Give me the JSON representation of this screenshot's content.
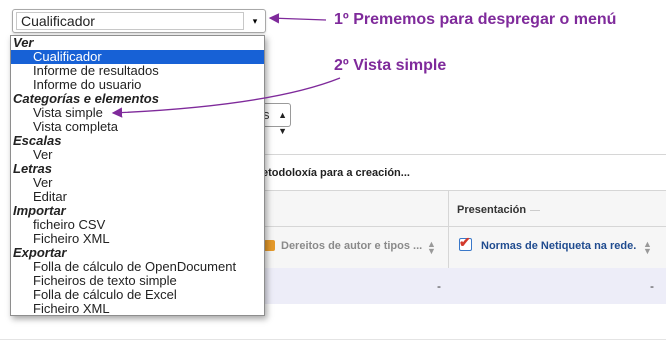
{
  "select": {
    "value": "Cualificador",
    "arrow": "▾"
  },
  "dropdown": {
    "groups": [
      {
        "label": "Ver",
        "options": [
          "Cualificador",
          "Informe de resultados",
          "Informe do usuario"
        ]
      },
      {
        "label": "Categorías e elementos",
        "options": [
          "Vista simple",
          "Vista completa"
        ]
      },
      {
        "label": "Escalas",
        "options": [
          "Ver"
        ]
      },
      {
        "label": "Letras",
        "options": [
          "Ver",
          "Editar"
        ]
      },
      {
        "label": "Importar",
        "options": [
          "ficheiro CSV",
          "Ficheiro XML"
        ]
      },
      {
        "label": "Exportar",
        "options": [
          "Folla de cálculo de OpenDocument",
          "Ficheiros de texto simple",
          "Folla de cálculo de Excel",
          "Ficheiro XML"
        ]
      }
    ],
    "selected": "Cualificador"
  },
  "annotations": {
    "step1": "1º Prememos para despregar o menú",
    "step2": "2º Vista simple"
  },
  "background": {
    "view_select_partial": "s",
    "intro_partial": "etodoloxía para a creación...",
    "category_header": "Presentación",
    "items": [
      "Dereitos de autor e tipos ...",
      "Normas de Netiqueta na rede."
    ],
    "cell_values": [
      "-",
      "-"
    ]
  },
  "colors": {
    "annotation": "#7f2a9b",
    "selected": "#1761d6"
  }
}
